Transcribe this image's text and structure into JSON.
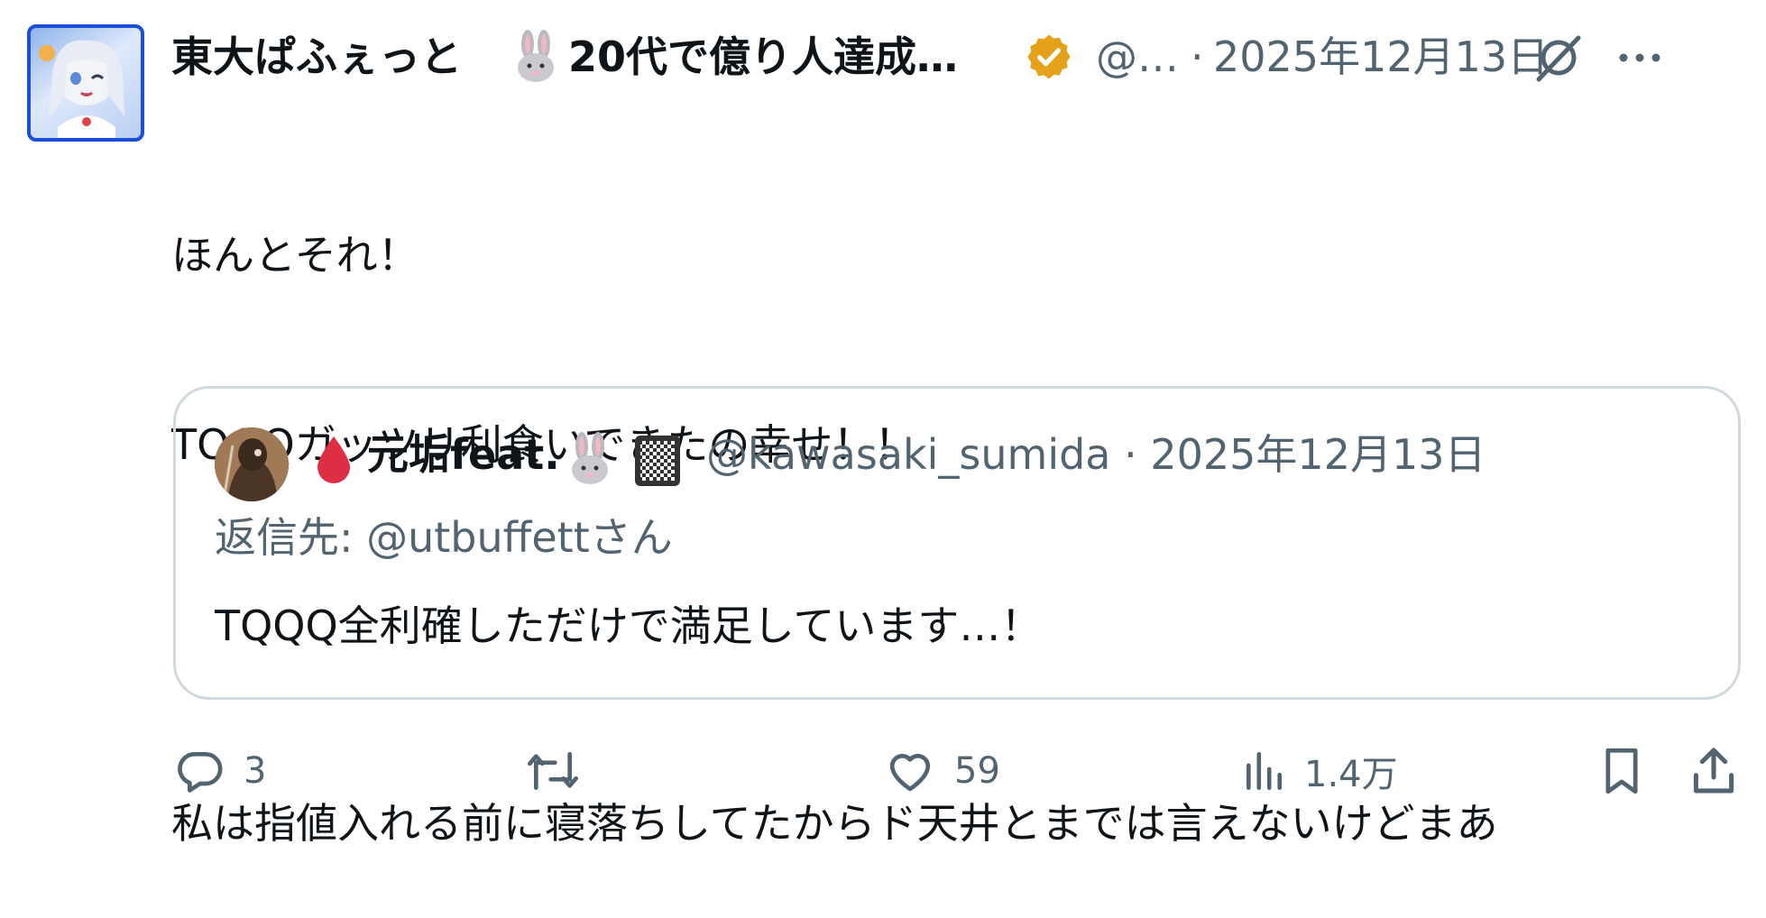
{
  "post": {
    "author": {
      "display_name": "東大ぱふぇっと",
      "name_tail": "20代で億り人達成…",
      "handle": "@…",
      "verified_icon": "verified-badge-icon",
      "avatar_icon": "anime-avatar"
    },
    "separator": "·",
    "timestamp": "2025年12月13日",
    "text_lines": [
      "ほんとそれ！",
      "TQQQガッツリ利食いできたの幸せ！！",
      "",
      "私は指値入れる前に寝落ちしてたからド天井とまでは言えないけどまあ"
    ]
  },
  "quote": {
    "display_name": "元垢feat.",
    "handle_time": "@kawasaki_sumida · 2025年12月13日",
    "reply_to": "返信先: @utbuffettさん",
    "text": "TQQQ全利確しただけで満足しています…！"
  },
  "actions": {
    "reply_count": "3",
    "retweet_count": "",
    "like_count": "59",
    "views_count": "1.4万"
  },
  "colors": {
    "text": "#0f1419",
    "secondary": "#536471",
    "border": "#cfd9de",
    "verified_gold": "#e3a21a",
    "avatar_border": "#1d4ed8",
    "drop_red": "#dd2e44"
  }
}
